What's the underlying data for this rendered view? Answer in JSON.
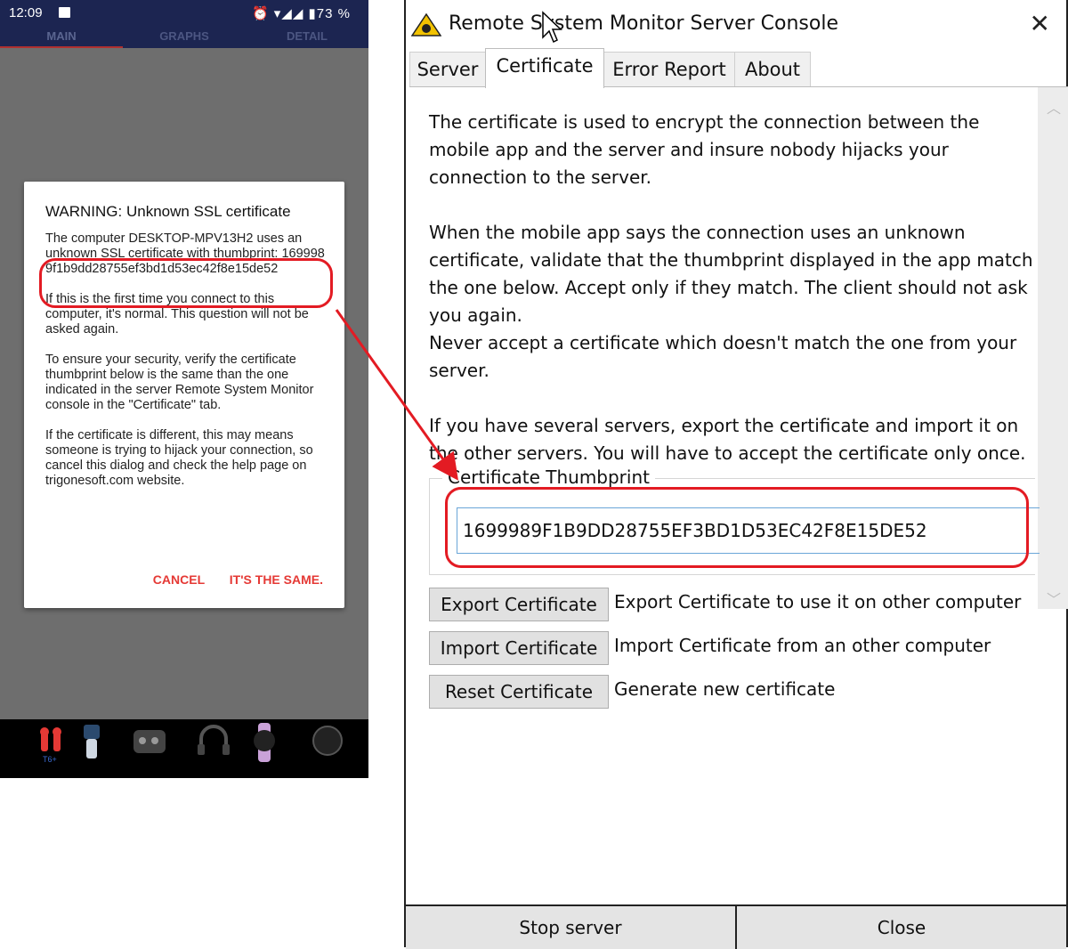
{
  "phone": {
    "status": {
      "time": "12:09",
      "icons": "⏰ ▾◢◢ ▮73 %"
    },
    "tabs": [
      "MAIN",
      "GRAPHS",
      "DETAIL"
    ],
    "dialog": {
      "title": "WARNING: Unknown SSL certificate",
      "intro": "The computer DESKTOP-MPV13H2 uses an unknown SSL certificate with thumbprint:",
      "thumbprint": "1699989f1b9dd28755ef3bd1d53ec42f8e15de52",
      "para1": "If this is the first time you connect to this computer, it's normal. This question will not be asked again.",
      "para2": "To ensure your security, verify the certificate thumbprint below is the same than the one indicated in the server Remote System Monitor console in the \"Certificate\" tab.",
      "para3": "If the certificate is different, this may means someone is trying to hijack your connection, so cancel this dialog and check the help page on trigonesoft.com website.",
      "cancel": "CANCEL",
      "confirm": "IT'S THE SAME."
    },
    "ads": {
      "badge": "T6+"
    }
  },
  "console": {
    "title": "Remote System Monitor Server Console",
    "tabs": [
      "Server",
      "Certificate",
      "Error Report",
      "About"
    ],
    "paragraphs": [
      "The certificate is used to encrypt the connection between the mobile app and the server and insure nobody hijacks your connection to the server.",
      "When the mobile app says the connection uses an unknown certificate, validate that the thumbprint displayed in the app match the one below. Accept only if they match. The client should not ask you again.",
      "Never accept a certificate which doesn't match the one from your server.",
      "If you have several servers, export the certificate and import it on the other servers. You will have to accept the certificate only once."
    ],
    "thumbprint_label": "Certificate Thumbprint",
    "thumbprint_value": "1699989F1B9DD28755EF3BD1D53EC42F8E15DE52",
    "buttons": [
      {
        "label": "Export Certificate",
        "desc": "Export  Certificate to use it on other computer"
      },
      {
        "label": "Import Certificate",
        "desc": "Import  Certificate from an other computer"
      },
      {
        "label": "Reset Certificate",
        "desc": "Generate new certificate"
      }
    ],
    "bottom": {
      "stop": "Stop server",
      "close": "Close"
    }
  },
  "colors": {
    "highlight": "#e31b23",
    "android_accent": "#e53935",
    "app_bar": "#1c2551"
  }
}
